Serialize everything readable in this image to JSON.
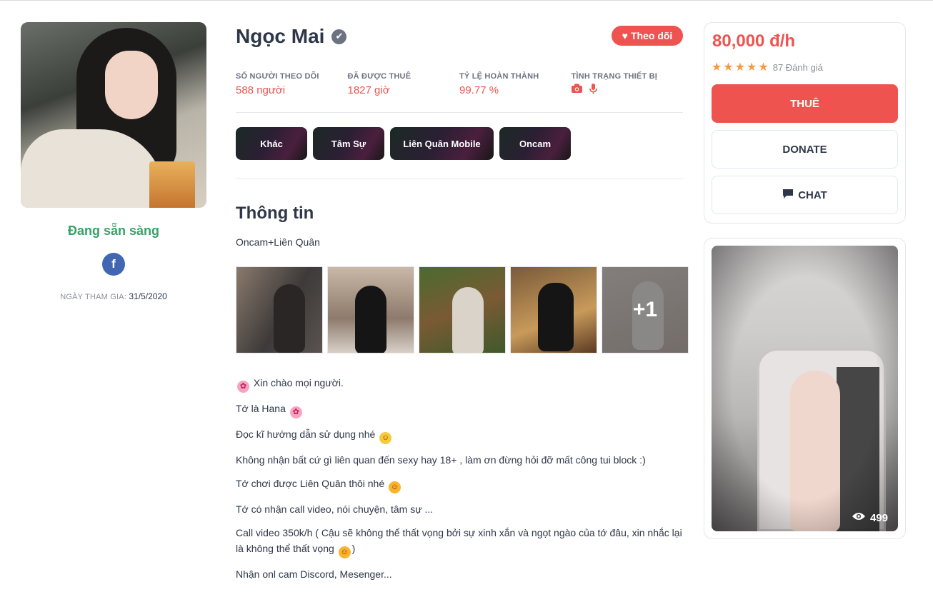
{
  "profile": {
    "name": "Ngọc Mai",
    "status": "Đang sẵn sàng",
    "join_label": "NGÀY THAM GIA:",
    "join_date": "31/5/2020",
    "follow_label": "Theo dõi"
  },
  "stats": [
    {
      "label": "SỐ NGƯỜI THEO DÕI",
      "value": "588 người"
    },
    {
      "label": "ĐÃ ĐƯỢC THUÊ",
      "value": "1827 giờ"
    },
    {
      "label": "TỶ LỆ HOÀN THÀNH",
      "value": "99.77 %"
    },
    {
      "label": "TÌNH TRẠNG THIẾT BỊ",
      "icons": [
        "camera-icon",
        "microphone-icon"
      ]
    }
  ],
  "tags": [
    "Khác",
    "Tâm Sự",
    "Liên Quân Mobile",
    "Oncam"
  ],
  "info": {
    "title": "Thông tin",
    "short": "Oncam+Liên Quân",
    "gallery_more": "+1"
  },
  "bio": [
    "Xin chào mọi người.",
    "Tớ là Hana",
    "Đọc kĩ hướng dẫn sử dụng nhé",
    "Không nhận bất cứ gì liên quan đến sexy hay 18+ , làm ơn đừng hỏi đỡ mất công tui block :)",
    "Tớ chơi được Liên Quân thôi nhé",
    "Tớ có nhận call video, nói chuyện, tâm sự ...",
    "Call video 350k/h ( Cậu sẽ không thể thất vọng bởi sự xinh xắn và ngọt ngào của tớ đâu, xin nhắc lại là không thể thất vọng",
    "Nhận onl cam Discord, Mesenger..."
  ],
  "pricing": {
    "price": "80,000 đ/h",
    "rating_stars": 5,
    "rating_text": "87 Đánh giá",
    "hire_label": "THUÊ",
    "donate_label": "DONATE",
    "chat_label": "CHAT"
  },
  "media": {
    "views": "499"
  },
  "colors": {
    "accent": "#ef5350",
    "online": "#38a169",
    "facebook": "#4267b2",
    "star": "#f6993f"
  }
}
